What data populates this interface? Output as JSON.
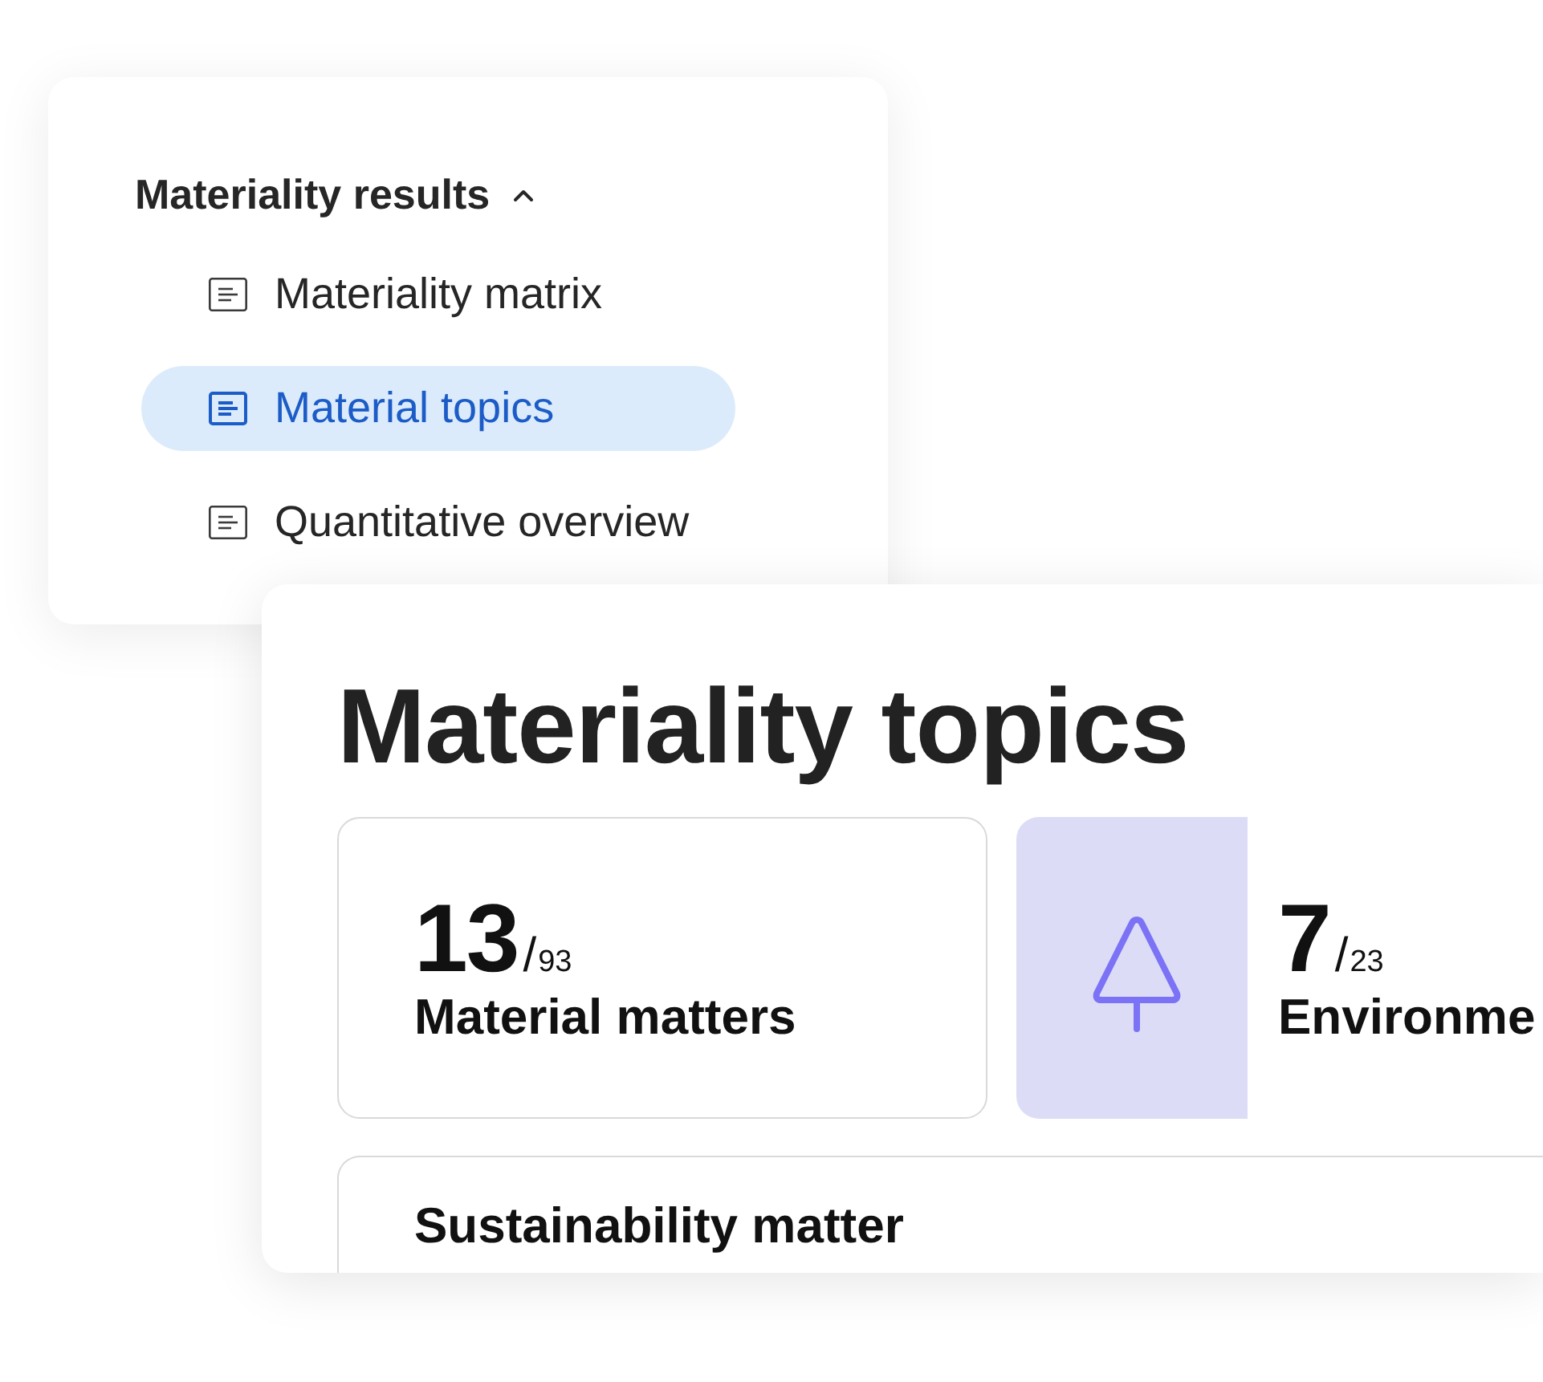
{
  "nav_panel": {
    "section": {
      "label": "Materiality results",
      "expanded": true,
      "items": [
        {
          "label": "Materiality matrix",
          "selected": false
        },
        {
          "label": "Material topics",
          "selected": true
        },
        {
          "label": "Quantitative overview",
          "selected": false
        }
      ]
    }
  },
  "content_panel": {
    "title": "Materiality topics",
    "stats": [
      {
        "kind": "plain",
        "value": "13",
        "separator": "/",
        "total": "93",
        "label": "Material matters"
      },
      {
        "kind": "icon",
        "value": "7",
        "separator": "/",
        "total": "23",
        "label": "Environme"
      }
    ],
    "table": {
      "header": "Sustainability matter"
    }
  }
}
